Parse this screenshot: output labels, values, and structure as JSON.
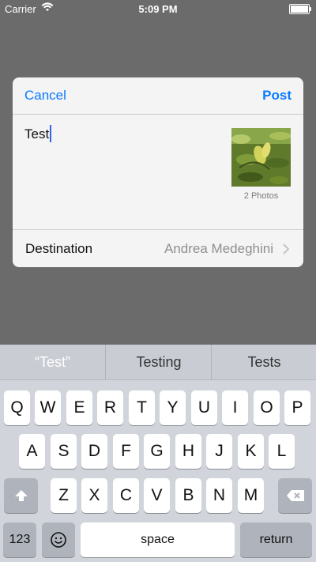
{
  "status_bar": {
    "carrier": "Carrier",
    "time": "5:09 PM"
  },
  "compose_sheet": {
    "cancel_label": "Cancel",
    "post_label": "Post",
    "text": "Test",
    "attachment_caption": "2 Photos",
    "destination_label": "Destination",
    "destination_value": "Andrea Medeghini"
  },
  "keyboard": {
    "suggestions": [
      "“Test”",
      "Testing",
      "Tests"
    ],
    "row1": [
      "Q",
      "W",
      "E",
      "R",
      "T",
      "Y",
      "U",
      "I",
      "O",
      "P"
    ],
    "row2": [
      "A",
      "S",
      "D",
      "F",
      "G",
      "H",
      "J",
      "K",
      "L"
    ],
    "row3": [
      "Z",
      "X",
      "C",
      "V",
      "B",
      "N",
      "M"
    ],
    "numbers_label": "123",
    "space_label": "space",
    "return_label": "return"
  },
  "colors": {
    "accent": "#0a7bff",
    "dim_background": "#6b6b6b",
    "keyboard_bg": "#d1d5db"
  }
}
